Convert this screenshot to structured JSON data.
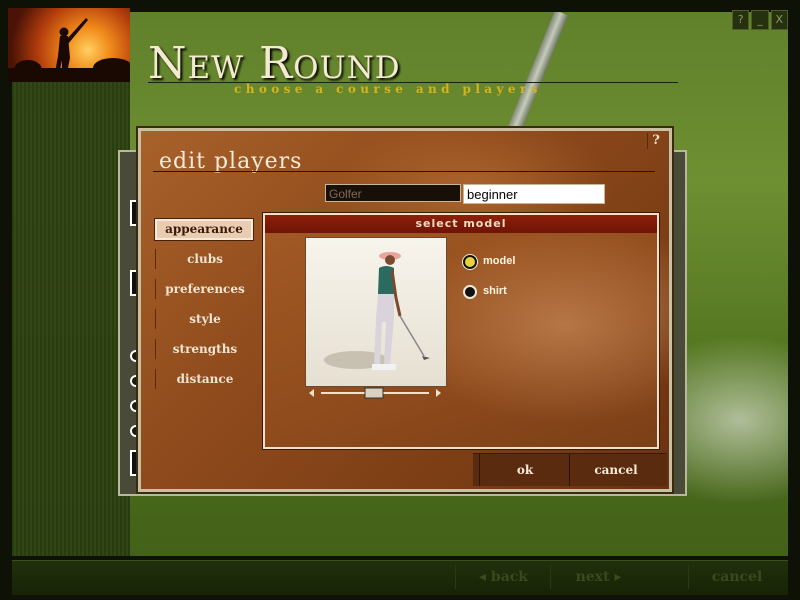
{
  "window": {
    "title": "New Round",
    "subtitle": "choose a course and players",
    "buttons": {
      "help": "?",
      "minimize": "_",
      "close": "X"
    }
  },
  "dialog": {
    "title": "edit players",
    "help": "?",
    "name_value": "Golfer",
    "level_value": "beginner",
    "tabs": [
      {
        "label": "appearance",
        "active": true
      },
      {
        "label": "clubs"
      },
      {
        "label": "preferences"
      },
      {
        "label": "style"
      },
      {
        "label": "strengths"
      },
      {
        "label": "distance"
      }
    ],
    "content": {
      "header": "select model",
      "options": [
        {
          "label": "model",
          "selected": true
        },
        {
          "label": "shirt",
          "selected": false
        }
      ]
    },
    "ok_label": "ok",
    "cancel_label": "cancel"
  },
  "bottom_nav": {
    "back": "back",
    "next": "next",
    "cancel": "cancel"
  },
  "colors": {
    "accent_gold": "#d6b31a",
    "dialog_brown": "#8e4a1c",
    "header_red": "#8e1f0a"
  }
}
